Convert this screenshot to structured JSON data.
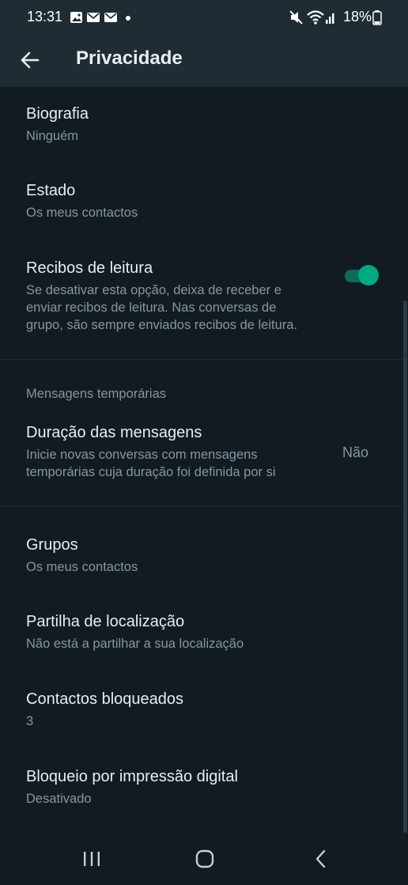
{
  "status_bar": {
    "time": "13:31",
    "battery": "18%"
  },
  "header": {
    "title": "Privacidade"
  },
  "rows": {
    "bio": {
      "title": "Biografia",
      "value": "Ninguém"
    },
    "status": {
      "title": "Estado",
      "value": "Os meus contactos"
    },
    "read_receipts": {
      "title": "Recibos de leitura",
      "description_lines": [
        "Se desativar esta opção, deixa de receber e",
        "enviar recibos de leitura. Nas conversas de",
        "grupo, são sempre enviados recibos de leitura."
      ],
      "enabled": true
    },
    "temporary_section": "Mensagens temporárias",
    "duration": {
      "title": "Duração das mensagens",
      "description_lines": [
        "Inicie novas conversas com mensagens",
        "temporárias cuja duração foi definida por si"
      ],
      "value": "Não"
    },
    "groups": {
      "title": "Grupos",
      "value": "Os meus contactos"
    },
    "location": {
      "title": "Partilha de localização",
      "value": "Não está a partilhar a sua localização"
    },
    "blocked": {
      "title": "Contactos bloqueados",
      "value": "3"
    },
    "fingerprint": {
      "title": "Bloqueio por impressão digital",
      "value": "Desativado"
    }
  },
  "colors": {
    "background": "#121b22",
    "bar": "#1f2c34",
    "accent": "#00a884",
    "primary_text": "#e9edef",
    "secondary_text": "#8696a0"
  },
  "icons": {
    "back": "arrow-left-icon",
    "notifications": [
      "image-icon",
      "mail-icon",
      "mail-icon",
      "dot-icon"
    ],
    "status_right": [
      "mute-icon",
      "wifi-icon",
      "signal-icon",
      "battery-icon"
    ],
    "nav": [
      "recent-apps-icon",
      "home-icon",
      "back-nav-icon"
    ]
  }
}
